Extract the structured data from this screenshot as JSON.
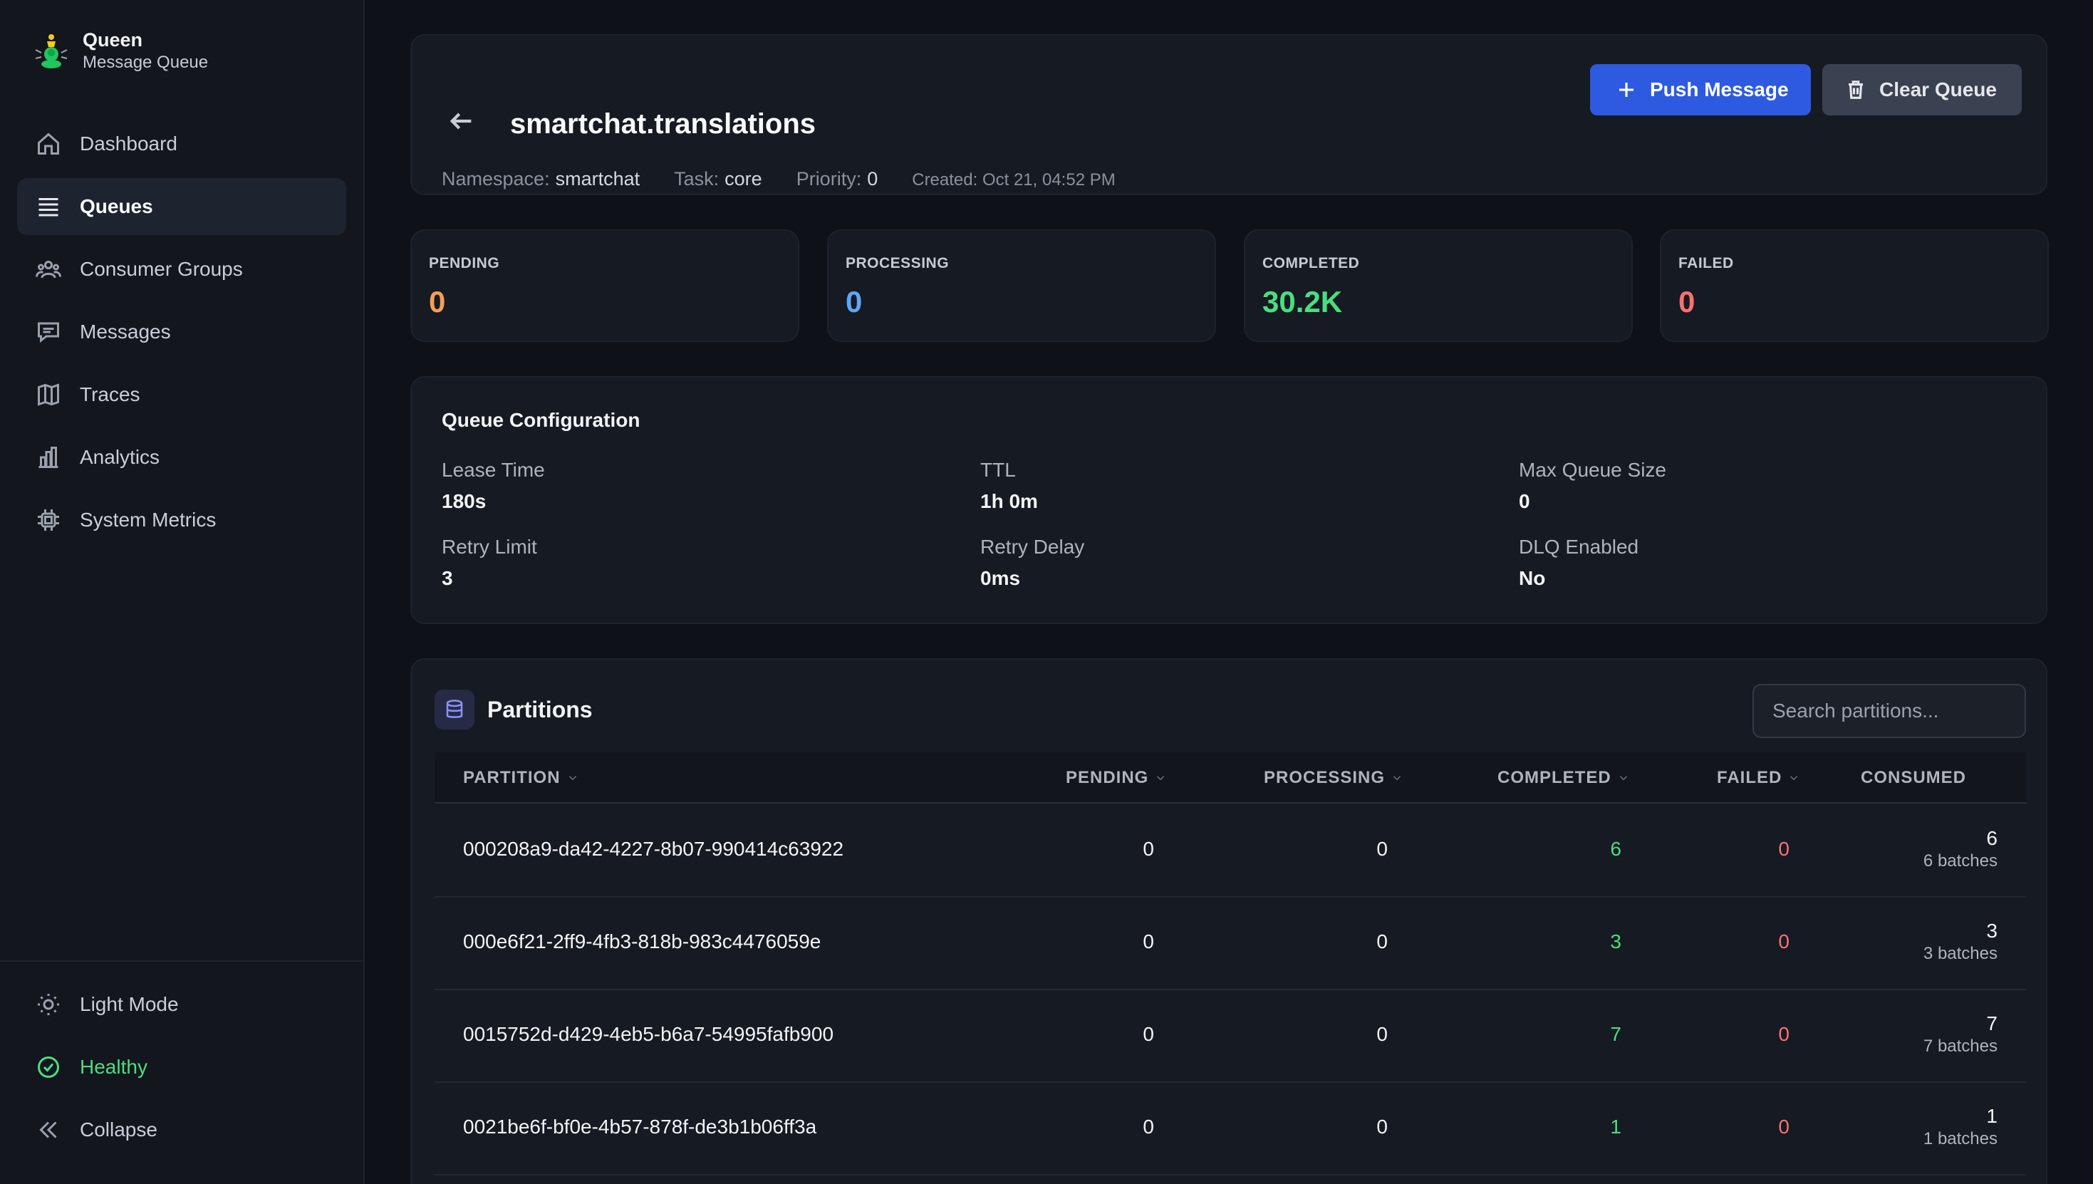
{
  "brand": {
    "name": "Queen",
    "subtitle": "Message Queue"
  },
  "nav": [
    {
      "label": "Dashboard",
      "icon": "home-icon"
    },
    {
      "label": "Queues",
      "icon": "list-icon",
      "active": true
    },
    {
      "label": "Consumer Groups",
      "icon": "users-icon"
    },
    {
      "label": "Messages",
      "icon": "message-icon"
    },
    {
      "label": "Traces",
      "icon": "map-icon"
    },
    {
      "label": "Analytics",
      "icon": "bar-chart-icon"
    },
    {
      "label": "System Metrics",
      "icon": "cpu-icon"
    }
  ],
  "sidebar_bottom": {
    "theme": "Light Mode",
    "health": "Healthy",
    "collapse": "Collapse"
  },
  "header": {
    "title": "smartchat.translations",
    "namespace_label": "Namespace:",
    "namespace": "smartchat",
    "task_label": "Task:",
    "task": "core",
    "priority_label": "Priority:",
    "priority": "0",
    "created": "Created: Oct 21, 04:52 PM",
    "push_label": "Push Message",
    "clear_label": "Clear Queue"
  },
  "stats": [
    {
      "label": "PENDING",
      "value": "0",
      "color": "#f59e54"
    },
    {
      "label": "PROCESSING",
      "value": "0",
      "color": "#60a5fa"
    },
    {
      "label": "COMPLETED",
      "value": "30.2K",
      "color": "#4ade80"
    },
    {
      "label": "FAILED",
      "value": "0",
      "color": "#f87171"
    }
  ],
  "config": {
    "title": "Queue Configuration",
    "items": [
      {
        "label": "Lease Time",
        "value": "180s"
      },
      {
        "label": "TTL",
        "value": "1h 0m"
      },
      {
        "label": "Max Queue Size",
        "value": "0"
      },
      {
        "label": "Retry Limit",
        "value": "3"
      },
      {
        "label": "Retry Delay",
        "value": "0ms"
      },
      {
        "label": "DLQ Enabled",
        "value": "No"
      }
    ]
  },
  "partitions": {
    "title": "Partitions",
    "search_placeholder": "Search partitions...",
    "columns": {
      "partition": "PARTITION",
      "pending": "PENDING",
      "processing": "PROCESSING",
      "completed": "COMPLETED",
      "failed": "FAILED",
      "consumed": "CONSUMED"
    },
    "rows": [
      {
        "id": "000208a9-da42-4227-8b07-990414c63922",
        "pending": "0",
        "processing": "0",
        "completed": "6",
        "failed": "0",
        "consumed": "6",
        "batches": "6 batches"
      },
      {
        "id": "000e6f21-2ff9-4fb3-818b-983c4476059e",
        "pending": "0",
        "processing": "0",
        "completed": "3",
        "failed": "0",
        "consumed": "3",
        "batches": "3 batches"
      },
      {
        "id": "0015752d-d429-4eb5-b6a7-54995fafb900",
        "pending": "0",
        "processing": "0",
        "completed": "7",
        "failed": "0",
        "consumed": "7",
        "batches": "7 batches"
      },
      {
        "id": "0021be6f-bf0e-4b57-878f-de3b1b06ff3a",
        "pending": "0",
        "processing": "0",
        "completed": "1",
        "failed": "0",
        "consumed": "1",
        "batches": "1 batches"
      }
    ]
  }
}
